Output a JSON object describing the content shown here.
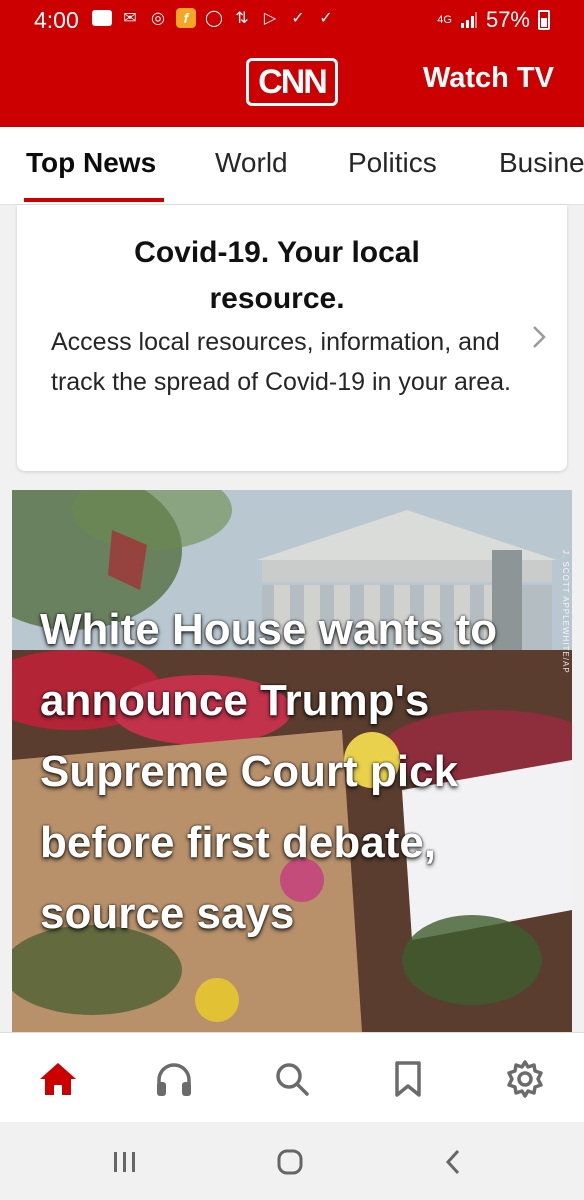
{
  "status_bar": {
    "time": "4:00",
    "network": "4G",
    "battery": "57%"
  },
  "header": {
    "logo": "CNN",
    "watch_tv": "Watch TV"
  },
  "tabs": [
    {
      "label": "Top News",
      "active": true
    },
    {
      "label": "World"
    },
    {
      "label": "Politics"
    },
    {
      "label": "Business"
    }
  ],
  "covid_card": {
    "title": "Covid-19. Your local resource.",
    "body": "Access local resources, information, and track the spread of Covid-19 in your area."
  },
  "hero": {
    "headline": "White House wants to announce Trump's Supreme Court pick before first debate, source says",
    "photo_credit": "J. SCOTT APPLEWHITE/AP"
  },
  "bottom_nav": [
    {
      "name": "home",
      "icon": "home-icon",
      "active": true
    },
    {
      "name": "listen",
      "icon": "headphones-icon"
    },
    {
      "name": "search",
      "icon": "search-icon"
    },
    {
      "name": "saved",
      "icon": "bookmark-icon"
    },
    {
      "name": "settings",
      "icon": "gear-icon"
    }
  ],
  "colors": {
    "brand": "#cc0000",
    "nav_inactive": "#6b6b6b"
  }
}
